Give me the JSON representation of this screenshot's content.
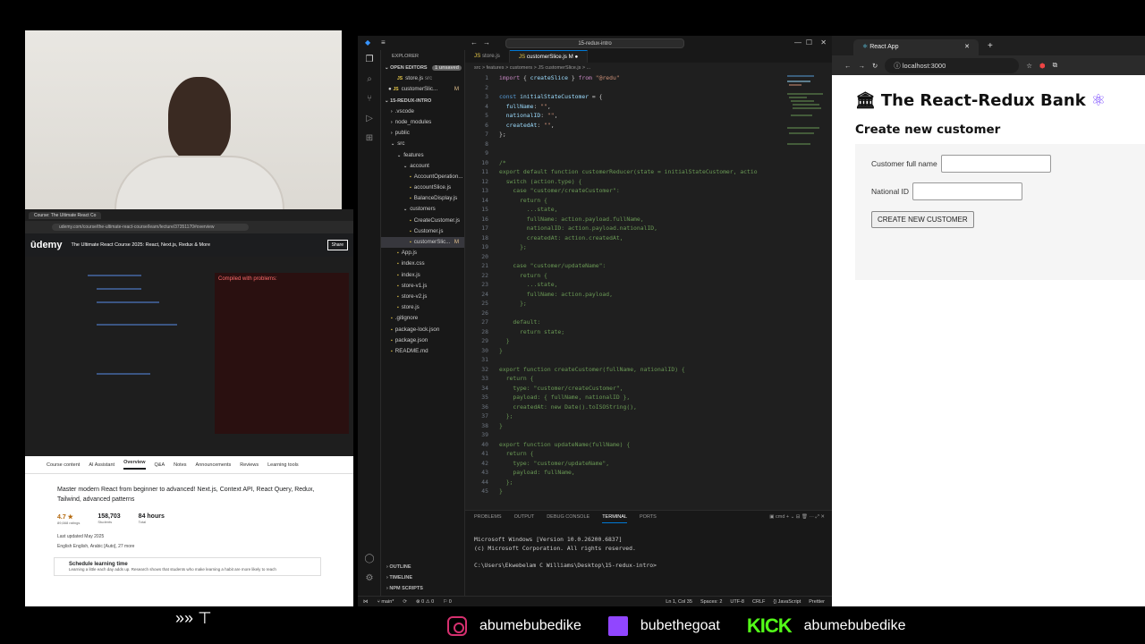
{
  "udemy": {
    "tab_title": "Course: The Ultimate React Co",
    "url": "udemy.com/course/the-ultimate-react-course/learn/lecture/37351170#overview",
    "logo": "ūdemy",
    "course_title": "The Ultimate React Course 2025: React, Next.js, Redux & More",
    "share_label": "Share",
    "video_overlay": "Compiled with problems:",
    "tabs": [
      "Course content",
      "AI Assistant",
      "Overview",
      "Q&A",
      "Notes",
      "Announcements",
      "Reviews",
      "Learning tools"
    ],
    "description": "Master modern React from beginner to advanced! Next.js, Context API, React Query, Redux, Tailwind, advanced patterns",
    "rating": "4.7 ★",
    "ratings_count": "89,668 ratings",
    "students": "158,703",
    "students_label": "Students",
    "hours": "84 hours",
    "hours_label": "Total",
    "updated": "Last updated May 2025",
    "languages": "English  English, Arabic [Auto], 27 more",
    "schedule": "Schedule learning time",
    "schedule_sub": "Learning a little each day adds up. Research shows that students who make learning a habit are more likely to reach"
  },
  "vscode": {
    "search": "15-redux-intro",
    "explorer_label": "EXPLORER",
    "open_editors": "OPEN EDITORS",
    "unsaved": "1 unsaved",
    "open_files": [
      {
        "name": "store.js",
        "hint": "src"
      },
      {
        "name": "customerSlic...",
        "hint": "M"
      }
    ],
    "project": "15-REDUX-INTRO",
    "tree": [
      {
        "name": ".vscode",
        "depth": 1,
        "type": "folder"
      },
      {
        "name": "node_modules",
        "depth": 1,
        "type": "folder"
      },
      {
        "name": "public",
        "depth": 1,
        "type": "folder"
      },
      {
        "name": "src",
        "depth": 1,
        "type": "folder-open"
      },
      {
        "name": "features",
        "depth": 2,
        "type": "folder-open"
      },
      {
        "name": "account",
        "depth": 3,
        "type": "folder-open"
      },
      {
        "name": "AccountOperation...",
        "depth": 4,
        "type": "file"
      },
      {
        "name": "accountSlice.js",
        "depth": 4,
        "type": "file"
      },
      {
        "name": "BalanceDisplay.js",
        "depth": 4,
        "type": "file"
      },
      {
        "name": "customers",
        "depth": 3,
        "type": "folder-open"
      },
      {
        "name": "CreateCustomer.js",
        "depth": 4,
        "type": "file"
      },
      {
        "name": "Customer.js",
        "depth": 4,
        "type": "file"
      },
      {
        "name": "customerSlic...",
        "depth": 4,
        "type": "file",
        "mod": "M"
      },
      {
        "name": "App.js",
        "depth": 2,
        "type": "file"
      },
      {
        "name": "index.css",
        "depth": 2,
        "type": "file"
      },
      {
        "name": "index.js",
        "depth": 2,
        "type": "file"
      },
      {
        "name": "store-v1.js",
        "depth": 2,
        "type": "file"
      },
      {
        "name": "store-v2.js",
        "depth": 2,
        "type": "file"
      },
      {
        "name": "store.js",
        "depth": 2,
        "type": "file"
      },
      {
        "name": ".gitignore",
        "depth": 1,
        "type": "file"
      },
      {
        "name": "package-lock.json",
        "depth": 1,
        "type": "file"
      },
      {
        "name": "package.json",
        "depth": 1,
        "type": "file"
      },
      {
        "name": "README.md",
        "depth": 1,
        "type": "file"
      }
    ],
    "tabs": [
      "store.js",
      "customerSlice.js M"
    ],
    "breadcrumb": "src > features > customers > JS customerSlice.js > ...",
    "panel_tabs": [
      "PROBLEMS",
      "OUTPUT",
      "DEBUG CONSOLE",
      "TERMINAL",
      "PORTS"
    ],
    "terminal_shell": "cmd",
    "terminal": "Microsoft Windows [Version 10.0.26200.6837]\n(c) Microsoft Corporation. All rights reserved.\n\nC:\\Users\\Ekwebelam C Williams\\Desktop\\15-redux-intro>",
    "outline": [
      "OUTLINE",
      "TIMELINE",
      "NPM SCRIPTS"
    ],
    "status_left": [
      "main*",
      "⊗ 0 ⚠ 0",
      "0"
    ],
    "status_right": [
      "Ln 1, Col 35",
      "Spaces: 2",
      "UTF-8",
      "CRLF",
      "{} JavaScript",
      "Prettier"
    ]
  },
  "browser": {
    "tab_title": "React App",
    "url": "localhost:3000",
    "app_title": "The React-Redux Bank",
    "section_title": "Create new customer",
    "full_name_label": "Customer full name",
    "national_id_label": "National ID",
    "full_name_value": "",
    "national_id_value": "",
    "create_button": "CREATE NEW CUSTOMER"
  },
  "socials": {
    "instagram": "abumebubedike",
    "twitch": "bubethegoat",
    "kick_logo": "KICK",
    "kick": "abumebubedike"
  },
  "overlay_left": "»» ⊤"
}
